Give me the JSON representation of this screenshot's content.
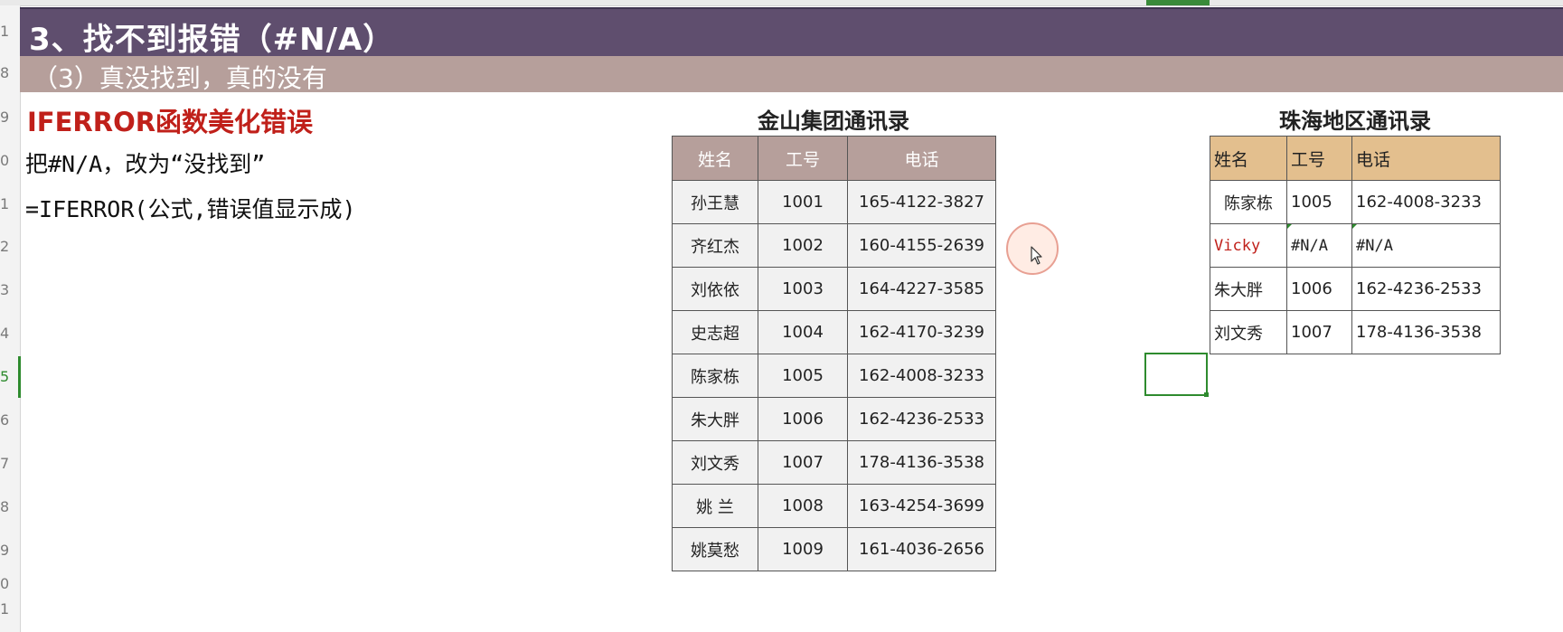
{
  "row_numbers": [
    "1",
    "8",
    "9",
    "0",
    "1",
    "2",
    "3",
    "4",
    "5",
    "6",
    "7",
    "8",
    "9",
    "0",
    "1"
  ],
  "banner": {
    "title": "3、找不到报错（#N/A）",
    "subtitle": "（3）真没找到，真的没有"
  },
  "notes": {
    "heading": "IFERROR函数美化错误",
    "line1": "把#N/A，改为“没找到”",
    "line2": "=IFERROR(公式,错误值显示成)"
  },
  "table1": {
    "title": "金山集团通讯录",
    "headers": [
      "姓名",
      "工号",
      "电话"
    ],
    "rows": [
      [
        "孙王慧",
        "1001",
        "165-4122-3827"
      ],
      [
        "齐红杰",
        "1002",
        "160-4155-2639"
      ],
      [
        "刘依依",
        "1003",
        "164-4227-3585"
      ],
      [
        "史志超",
        "1004",
        "162-4170-3239"
      ],
      [
        "陈家栋",
        "1005",
        "162-4008-3233"
      ],
      [
        "朱大胖",
        "1006",
        "162-4236-2533"
      ],
      [
        "刘文秀",
        "1007",
        "178-4136-3538"
      ],
      [
        "姚 兰",
        "1008",
        "163-4254-3699"
      ],
      [
        "姚莫愁",
        "1009",
        "161-4036-2656"
      ]
    ]
  },
  "table2": {
    "title": "珠海地区通讯录",
    "headers": [
      "姓名",
      "工号",
      "电话"
    ],
    "rows": [
      [
        "陈家栋",
        "1005",
        "162-4008-3233"
      ],
      [
        "Vicky",
        "#N/A",
        "#N/A"
      ],
      [
        "朱大胖",
        "1006",
        "162-4236-2533"
      ],
      [
        "刘文秀",
        "1007",
        "178-4136-3538"
      ]
    ]
  },
  "colors": {
    "banner_primary": "#5f4e6e",
    "banner_secondary": "#b69f9b",
    "table1_header": "#b69f9b",
    "table2_header": "#e3bf8e",
    "error_text": "#c0201a",
    "selection": "#2e8b2e"
  },
  "icons": {
    "cursor": "mouse-pointer-icon"
  }
}
